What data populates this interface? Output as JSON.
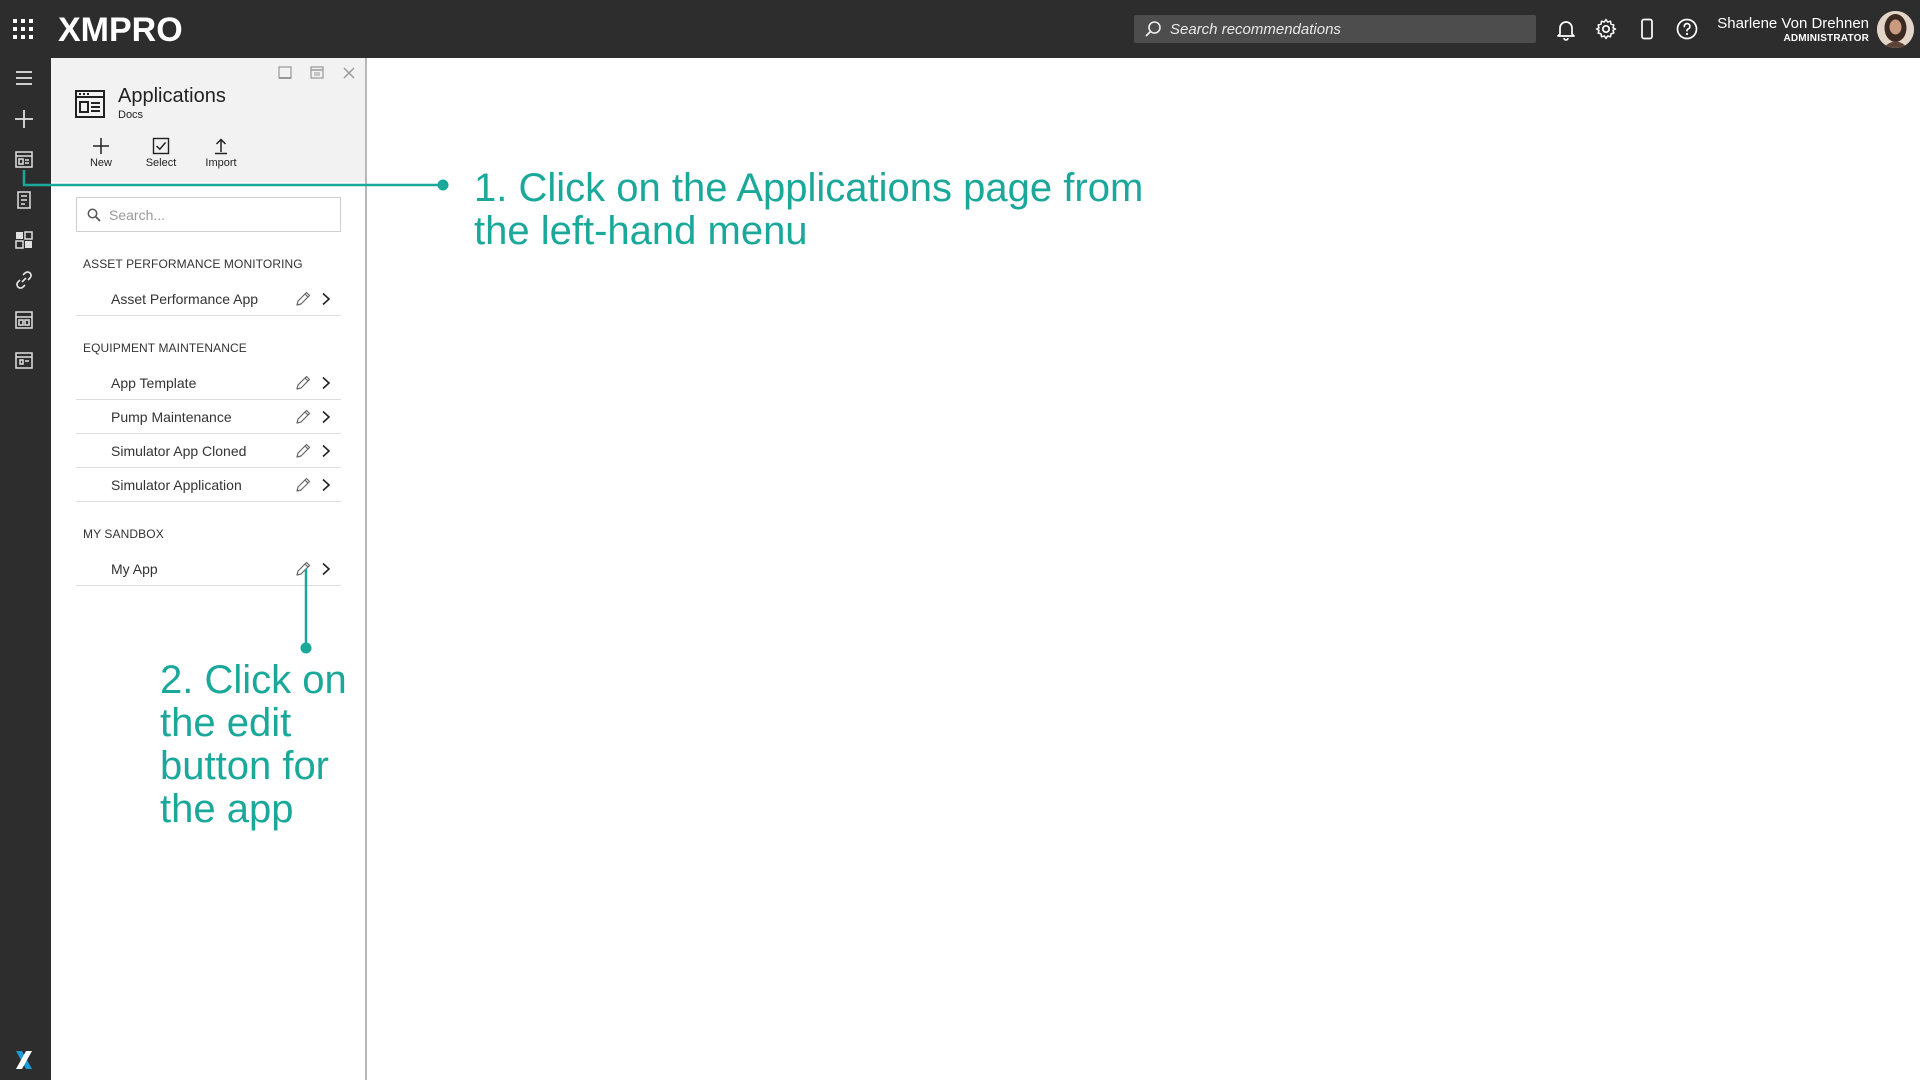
{
  "topbar": {
    "logo": "XMPRO",
    "search_placeholder": "Search recommendations",
    "icons": [
      "apps-grid-icon",
      "bell-icon",
      "gear-icon",
      "mobile-icon",
      "help-icon"
    ],
    "user_name": "Sharlene Von Drehnen",
    "user_role": "ADMINISTRATOR"
  },
  "leftnav": {
    "icons": [
      "hamburger-menu-icon",
      "plus-icon",
      "applications-icon",
      "recommendations-icon",
      "dashboard-icon",
      "integrations-link-icon",
      "data-streams-icon",
      "calendar-icon",
      "xmpro-logo-icon"
    ]
  },
  "panel": {
    "title": "Applications",
    "subtitle": "Docs",
    "toolbar": {
      "new_label": "New",
      "select_label": "Select",
      "import_label": "Import"
    },
    "search_placeholder": "Search...",
    "groups": [
      {
        "name": "ASSET PERFORMANCE MONITORING",
        "items": [
          "Asset Performance App"
        ]
      },
      {
        "name": "EQUIPMENT MAINTENANCE",
        "items": [
          "App Template",
          "Pump Maintenance",
          "Simulator App Cloned",
          "Simulator Application"
        ]
      },
      {
        "name": "MY SANDBOX",
        "items": [
          "My App"
        ]
      }
    ]
  },
  "annotations": {
    "step1": "1. Click on the Applications page from the left-hand menu",
    "step1_line1": "1. Click on the Applications page from",
    "step1_line2": "the left-hand menu",
    "step2_lines": [
      "2. Click on",
      "the edit",
      "button for",
      "the app"
    ]
  },
  "colors": {
    "topbar_bg": "#2d2d2d",
    "panel_header_bg": "#f2f2f2",
    "annotation": "#1aa89a"
  }
}
